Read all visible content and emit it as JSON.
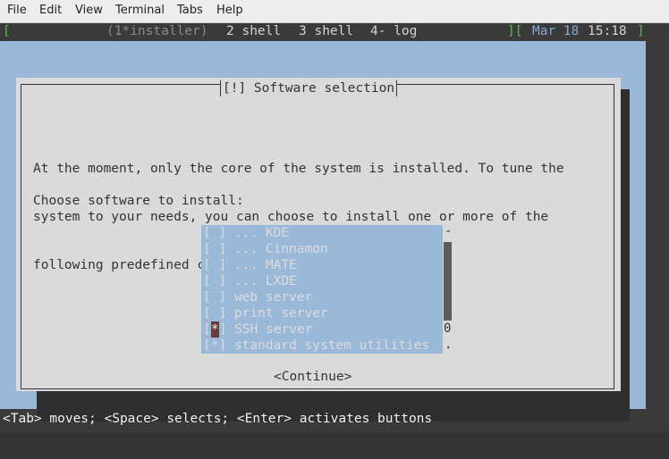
{
  "menubar": {
    "items": [
      "File",
      "Edit",
      "View",
      "Terminal",
      "Tabs",
      "Help"
    ]
  },
  "tabbar": {
    "left_bracket": "[",
    "tabs": [
      "(1*installer)",
      "2 shell",
      "3 shell",
      "4- log"
    ],
    "right_bracket_open": "][",
    "date": "Mar 18",
    "time": "15:18",
    "right_bracket_close": "]"
  },
  "dialog": {
    "title": "[!] Software selection",
    "description": [
      "At the moment, only the core of the system is installed. To tune the",
      "system to your needs, you can choose to install one or more of the",
      "following predefined collections of software."
    ],
    "prompt": "Choose software to install:",
    "options": [
      {
        "check": "[ ]",
        "label": "... KDE"
      },
      {
        "check": "[ ]",
        "label": "... Cinnamon"
      },
      {
        "check": "[ ]",
        "label": "... MATE"
      },
      {
        "check": "[ ]",
        "label": "... LXDE"
      },
      {
        "check": "[ ]",
        "label": "web server"
      },
      {
        "check": "[ ]",
        "label": "print server"
      },
      {
        "check": "[*]",
        "label": "SSH server"
      },
      {
        "check": "[*]",
        "label": "standard system utilities"
      }
    ],
    "scroll_markers": {
      "top": "-",
      "middle": "0",
      "bottom": "."
    },
    "continue_label": "<Continue>"
  },
  "helpbar": {
    "text": "<Tab> moves; <Space> selects; <Enter> activates buttons"
  },
  "colors": {
    "screen_bg": "#9ab8d8",
    "dialog_bg": "#dadada",
    "tabbar_green": "#56b94d"
  }
}
